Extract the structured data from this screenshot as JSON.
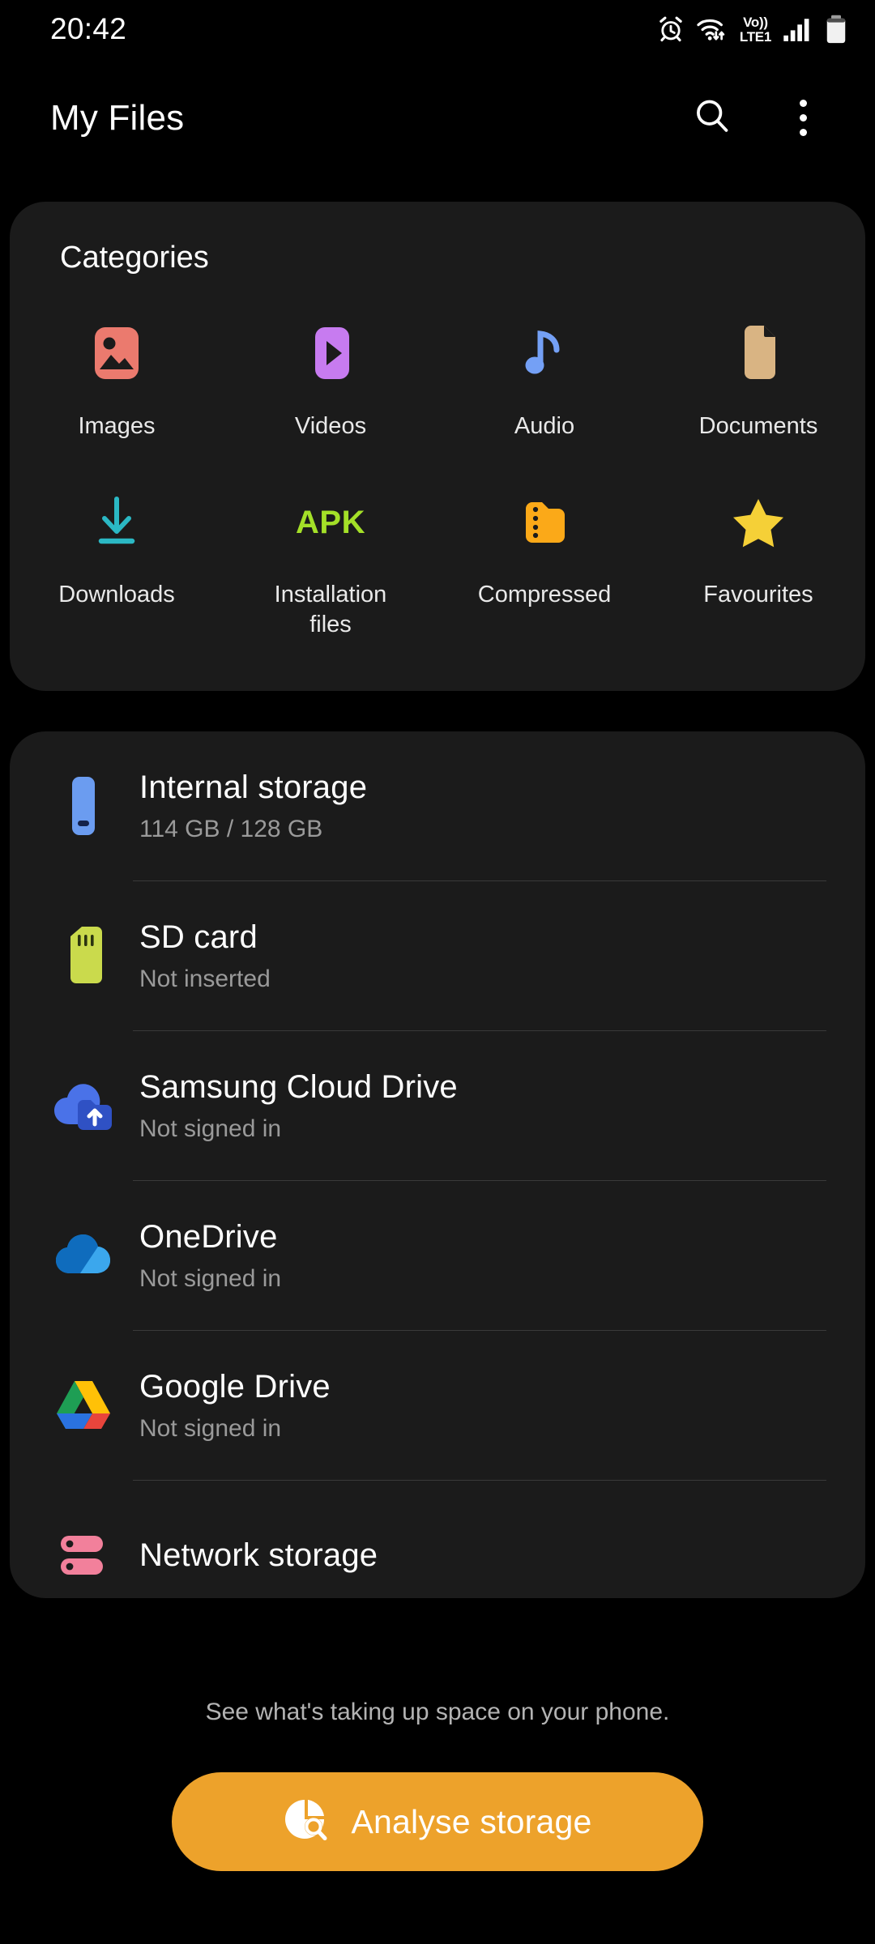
{
  "status_bar": {
    "time": "20:42",
    "icons": [
      {
        "name": "alarm-icon",
        "label": "Alarm"
      },
      {
        "name": "wifi-icon",
        "label": "Wi-Fi"
      },
      {
        "name": "volte-icon",
        "label_top": "Vo))",
        "label_bottom": "LTE1"
      },
      {
        "name": "signal-bars-icon",
        "label": "Signal"
      },
      {
        "name": "battery-icon",
        "label": "Battery"
      }
    ]
  },
  "app_bar": {
    "title": "My Files",
    "search_icon": "search-icon",
    "more_icon": "more-options-icon"
  },
  "categories": {
    "title": "Categories",
    "items": [
      {
        "label": "Images",
        "icon": "image-icon",
        "color": "#eb7a6e"
      },
      {
        "label": "Videos",
        "icon": "video-icon",
        "color": "#c77bf0"
      },
      {
        "label": "Audio",
        "icon": "audio-note-icon",
        "color": "#74a0f5"
      },
      {
        "label": "Documents",
        "icon": "document-icon",
        "color": "#d9b483"
      },
      {
        "label": "Downloads",
        "icon": "download-arrow-icon",
        "color": "#2bb8c4"
      },
      {
        "label": "Installation files",
        "icon": "apk-icon",
        "color": "#a4e028",
        "icon_text": "APK"
      },
      {
        "label": "Compressed",
        "icon": "zip-folder-icon",
        "color": "#fba918"
      },
      {
        "label": "Favourites",
        "icon": "star-icon",
        "color": "#f5d037"
      }
    ]
  },
  "storage": {
    "items": [
      {
        "title": "Internal storage",
        "subtitle": "114 GB / 128 GB",
        "icon": "phone-icon",
        "color": "#6b9cf0"
      },
      {
        "title": "SD card",
        "subtitle": "Not inserted",
        "icon": "sd-card-icon",
        "color": "#cada4c"
      },
      {
        "title": "Samsung Cloud Drive",
        "subtitle": "Not signed in",
        "icon": "samsung-cloud-icon",
        "color": "#4a72e8"
      },
      {
        "title": "OneDrive",
        "subtitle": "Not signed in",
        "icon": "onedrive-icon",
        "color": "#1a8fdd"
      },
      {
        "title": "Google Drive",
        "subtitle": "Not signed in",
        "icon": "google-drive-icon",
        "color": "#ffc107"
      },
      {
        "title": "Network storage",
        "subtitle": "",
        "icon": "network-storage-icon",
        "color": "#f2809b"
      }
    ]
  },
  "footer": {
    "note": "See what's taking up space on your phone.",
    "button_label": "Analyse storage",
    "button_icon": "storage-analysis-icon",
    "button_color": "#eda22b"
  }
}
